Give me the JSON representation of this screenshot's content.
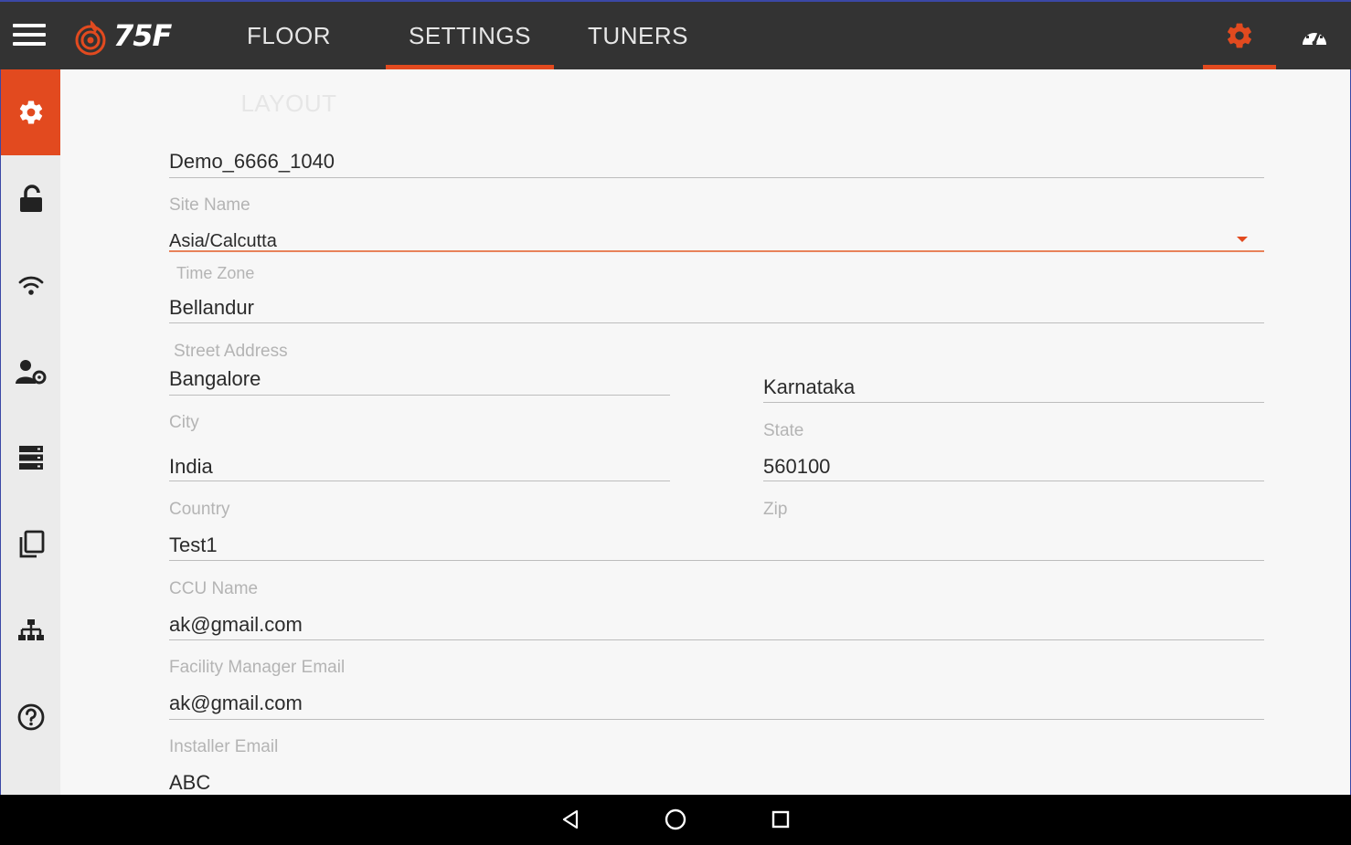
{
  "header": {
    "brand": "75F",
    "tabs": [
      {
        "label": "FLOOR LAYOUT",
        "active": false
      },
      {
        "label": "SETTINGS",
        "active": true
      },
      {
        "label": "TUNERS",
        "active": false
      }
    ],
    "right_icons": [
      "gear-icon",
      "dashboard-gauge-icon"
    ]
  },
  "sidebar": {
    "items": [
      {
        "icon": "gear-icon",
        "active": true
      },
      {
        "icon": "unlock-icon",
        "active": false
      },
      {
        "icon": "wifi-icon",
        "active": false
      },
      {
        "icon": "user-settings-icon",
        "active": false
      },
      {
        "icon": "server-list-icon",
        "active": false
      },
      {
        "icon": "copy-icon",
        "active": false
      },
      {
        "icon": "network-hierarchy-icon",
        "active": false
      },
      {
        "icon": "help-icon",
        "active": false
      }
    ]
  },
  "form": {
    "site_name": {
      "value": "Demo_6666_1040",
      "label": "Site Name"
    },
    "time_zone": {
      "value": "Asia/Calcutta",
      "label": "Time Zone"
    },
    "street_address": {
      "value": "Bellandur",
      "label": "Street Address"
    },
    "city": {
      "value": "Bangalore",
      "label": "City"
    },
    "state": {
      "value": "Karnataka",
      "label": "State"
    },
    "country": {
      "value": "India",
      "label": "Country"
    },
    "zip": {
      "value": "560100",
      "label": "Zip"
    },
    "ccu_name": {
      "value": "Test1",
      "label": "CCU Name"
    },
    "facility_manager_email": {
      "value": "ak@gmail.com",
      "label": "Facility Manager Email"
    },
    "installer_email": {
      "value": "ak@gmail.com",
      "label": "Installer Email"
    },
    "next_field": {
      "value": "ABC"
    }
  },
  "colors": {
    "accent": "#e24a1f",
    "topbar": "#333333",
    "sidebar": "#ebebeb",
    "background": "#f7f7f7"
  },
  "navbar": {
    "buttons": [
      "back-icon",
      "home-icon",
      "recents-icon"
    ]
  }
}
